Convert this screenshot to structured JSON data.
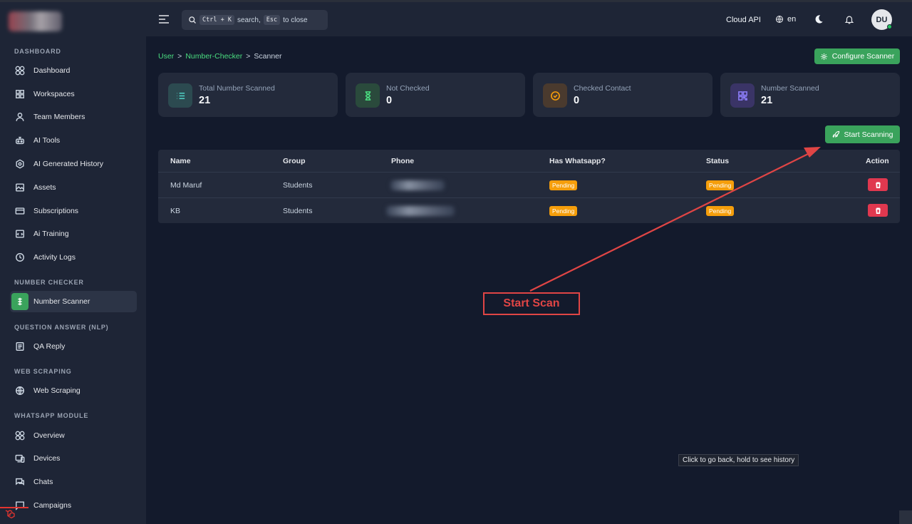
{
  "header": {
    "search": {
      "kbd_open": "Ctrl + K",
      "text_search": "search,",
      "kbd_close": "Esc",
      "text_close": "to close"
    },
    "cloud_api": "Cloud API",
    "language": "en",
    "avatar_initials": "DU"
  },
  "sidebar": {
    "sections": {
      "dashboard": "DASHBOARD",
      "number_checker": "NUMBER CHECKER",
      "qa": "QUESTION ANSWER (NLP)",
      "scraping": "WEB SCRAPING",
      "whatsapp": "WHATSAPP MODULE"
    },
    "items": {
      "dashboard": "Dashboard",
      "workspaces": "Workspaces",
      "team_members": "Team Members",
      "ai_tools": "AI Tools",
      "ai_history": "AI Generated History",
      "assets": "Assets",
      "subscriptions": "Subscriptions",
      "ai_training": "Ai Training",
      "activity_logs": "Activity Logs",
      "number_scanner": "Number Scanner",
      "qa_reply": "QA Reply",
      "web_scraping": "Web Scraping",
      "overview": "Overview",
      "devices": "Devices",
      "chats": "Chats",
      "campaigns": "Campaigns"
    }
  },
  "breadcrumb": {
    "user": "User",
    "number_checker": "Number-Checker",
    "scanner": "Scanner",
    "separator": ">"
  },
  "buttons": {
    "configure": "Configure Scanner",
    "start": "Start Scanning"
  },
  "stats": [
    {
      "label": "Total Number Scanned",
      "value": "21"
    },
    {
      "label": "Not Checked",
      "value": "0"
    },
    {
      "label": "Checked Contact",
      "value": "0"
    },
    {
      "label": "Number Scanned",
      "value": "21"
    }
  ],
  "table": {
    "headers": [
      "Name",
      "Group",
      "Phone",
      "Has Whatsapp?",
      "Status",
      "Action"
    ],
    "rows": [
      {
        "name": "Md Maruf",
        "group": "Students",
        "whatsapp": "Pending",
        "status": "Pending"
      },
      {
        "name": "KB",
        "group": "Students",
        "whatsapp": "Pending",
        "status": "Pending"
      }
    ]
  },
  "annotation": {
    "label": "Start Scan",
    "color": "#e04545"
  },
  "tooltip": "Click to go back, hold to see history",
  "colors": {
    "accent": "#3aa35c",
    "pending": "#f59e0b",
    "danger": "#e0384f"
  }
}
